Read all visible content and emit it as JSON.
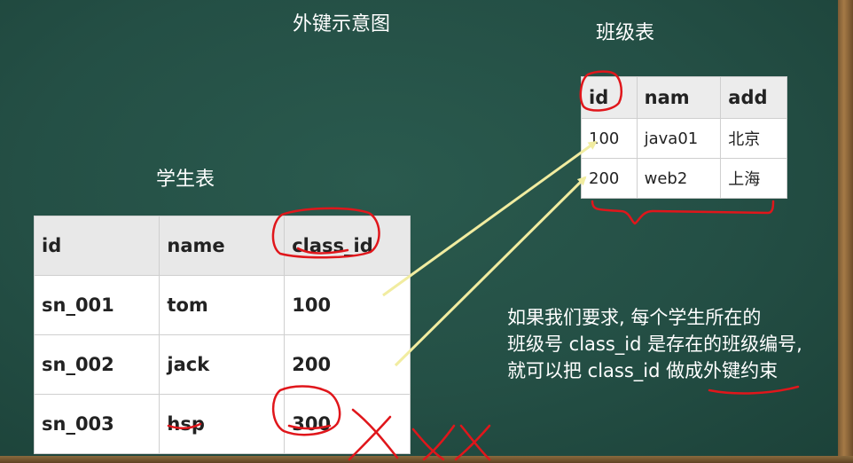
{
  "headings": {
    "diagram_title": "外键示意图",
    "class_table_title": "班级表",
    "student_table_title": "学生表"
  },
  "class_table": {
    "columns": [
      "id",
      "nam",
      "add"
    ],
    "rows": [
      [
        "100",
        "java01",
        "北京"
      ],
      [
        "200",
        "web2",
        "上海"
      ]
    ]
  },
  "student_table": {
    "columns": [
      "id",
      "name",
      "class_id"
    ],
    "rows": [
      [
        "sn_001",
        "tom",
        "100"
      ],
      [
        "sn_002",
        "jack",
        "200"
      ],
      [
        "sn_003",
        "hsp",
        "300"
      ]
    ]
  },
  "note": {
    "line1": "如果我们要求, 每个学生所在的",
    "line2": "班级号 class_id 是存在的班级编号,",
    "line3": "就可以把 class_id 做成外键约束"
  },
  "colors": {
    "board": "#244f45",
    "arrow": "#f1eca0",
    "annotation_red": "#e0161b"
  }
}
